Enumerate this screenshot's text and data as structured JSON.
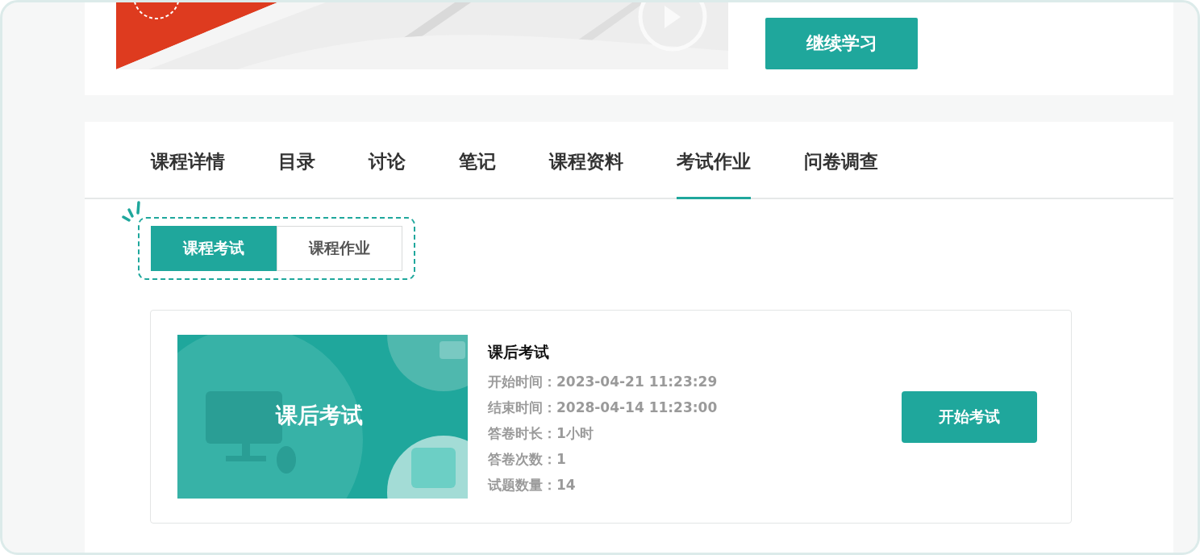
{
  "banner": {
    "kind": "picture",
    "button": "继续学习"
  },
  "tabs": [
    {
      "label": "课程详情",
      "selected": false
    },
    {
      "label": "目录",
      "selected": false
    },
    {
      "label": "讨论",
      "selected": false
    },
    {
      "label": "笔记",
      "selected": false
    },
    {
      "label": "课程资料",
      "selected": false
    },
    {
      "label": "考试作业",
      "selected": true
    },
    {
      "label": "问卷调查",
      "selected": false
    }
  ],
  "sub_tabs": [
    {
      "label": "课程考试",
      "selected": true
    },
    {
      "label": "课程作业",
      "selected": false
    }
  ],
  "exam": {
    "thumbnail": {
      "kind": "picture",
      "caption": "课后考试"
    },
    "title": "课后考试",
    "details": [
      "开始时间：2023-04-21 11:23:29",
      "结束时间：2028-04-14 11:23:00",
      "答卷时长：1小时",
      "答卷次数：1",
      "试题数量：14"
    ],
    "button": "开始考试"
  }
}
